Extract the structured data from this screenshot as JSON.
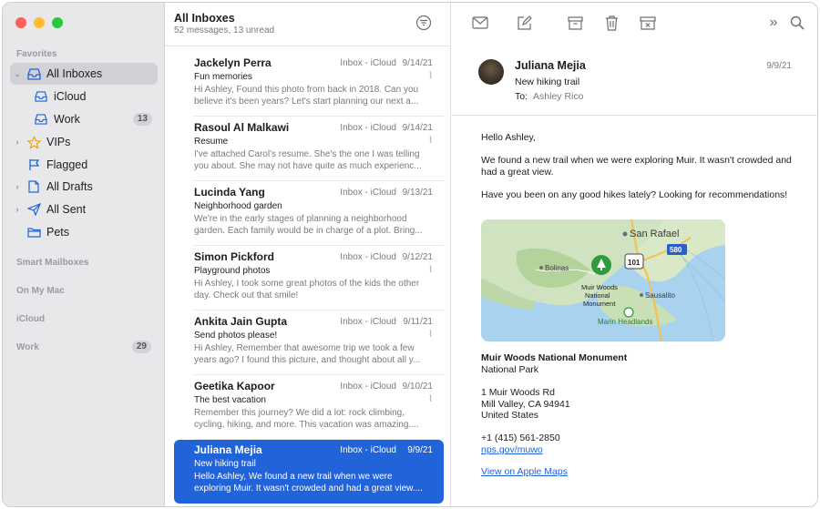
{
  "colors": {
    "accent": "#2163d8",
    "red": "#fe5f57",
    "yellow": "#febc2e",
    "green": "#28c840"
  },
  "sidebar": {
    "favorites_title": "Favorites",
    "items": [
      {
        "label": "All Inboxes",
        "icon": "tray-icon"
      },
      {
        "label": "iCloud",
        "icon": "tray-icon"
      },
      {
        "label": "Work",
        "icon": "tray-icon",
        "badge": "13"
      },
      {
        "label": "VIPs",
        "icon": "star-icon"
      },
      {
        "label": "Flagged",
        "icon": "flag-icon"
      },
      {
        "label": "All Drafts",
        "icon": "document-icon"
      },
      {
        "label": "All Sent",
        "icon": "paperplane-icon"
      },
      {
        "label": "Pets",
        "icon": "folder-icon"
      }
    ],
    "sections": [
      {
        "label": "Smart Mailboxes"
      },
      {
        "label": "On My Mac"
      },
      {
        "label": "iCloud"
      },
      {
        "label": "Work",
        "badge": "29"
      }
    ]
  },
  "list": {
    "title": "All Inboxes",
    "subtitle": "52 messages, 13 unread",
    "messages": [
      {
        "sender": "Jackelyn Perra",
        "mailbox": "Inbox - iCloud",
        "date": "9/14/21",
        "subject": "Fun memories",
        "preview": "Hi Ashley, Found this photo from back in 2018. Can you believe it's been years? Let's start planning our next a..."
      },
      {
        "sender": "Rasoul Al Malkawi",
        "mailbox": "Inbox - iCloud",
        "date": "9/14/21",
        "subject": "Resume",
        "preview": "I've attached Carol's resume. She's the one I was telling you about. She may not have quite as much experienc..."
      },
      {
        "sender": "Lucinda Yang",
        "mailbox": "Inbox - iCloud",
        "date": "9/13/21",
        "subject": "Neighborhood garden",
        "preview": "We're in the early stages of planning a neighborhood garden. Each family would be in charge of a plot. Bring..."
      },
      {
        "sender": "Simon Pickford",
        "mailbox": "Inbox - iCloud",
        "date": "9/12/21",
        "subject": "Playground photos",
        "preview": "Hi Ashley, I took some great photos of the kids the other day. Check out that smile!"
      },
      {
        "sender": "Ankita Jain Gupta",
        "mailbox": "Inbox - iCloud",
        "date": "9/11/21",
        "subject": "Send photos please!",
        "preview": "Hi Ashley, Remember that awesome trip we took a few years ago? I found this picture, and thought about all y..."
      },
      {
        "sender": "Geetika Kapoor",
        "mailbox": "Inbox - iCloud",
        "date": "9/10/21",
        "subject": "The best vacation",
        "preview": "Remember this journey? We did a lot: rock climbing, cycling, hiking, and more. This vacation was amazing...."
      },
      {
        "sender": "Juliana Mejia",
        "mailbox": "Inbox - iCloud",
        "date": "9/9/21",
        "subject": "New hiking trail",
        "preview": "Hello Ashley, We found a new trail when we were exploring Muir. It wasn't crowded and had a great view...."
      }
    ]
  },
  "reader": {
    "from": "Juliana Mejia",
    "date": "9/9/21",
    "subject": "New hiking trail",
    "to_label": "To:",
    "to": "Ashley Rico",
    "greeting": "Hello Ashley,",
    "para1": "We found a new trail when we were exploring Muir. It wasn't crowded and had a great view.",
    "para2": "Have you been on any good hikes lately? Looking for recommendations!",
    "map": {
      "labels": [
        "San Rafael",
        "Bolinas",
        "Muir Woods",
        "National",
        "Monument",
        "Sausalito",
        "Marin Headlands"
      ],
      "shields": [
        "101",
        "580"
      ]
    },
    "place_name": "Muir Woods National Monument",
    "place_type": "National Park",
    "address1": "1 Muir Woods Rd",
    "address2": "Mill Valley, CA 94941",
    "address3": "United States",
    "phone": "+1 (415) 561-2850",
    "website": "nps.gov/muwo",
    "maps_link": "View on Apple Maps"
  }
}
